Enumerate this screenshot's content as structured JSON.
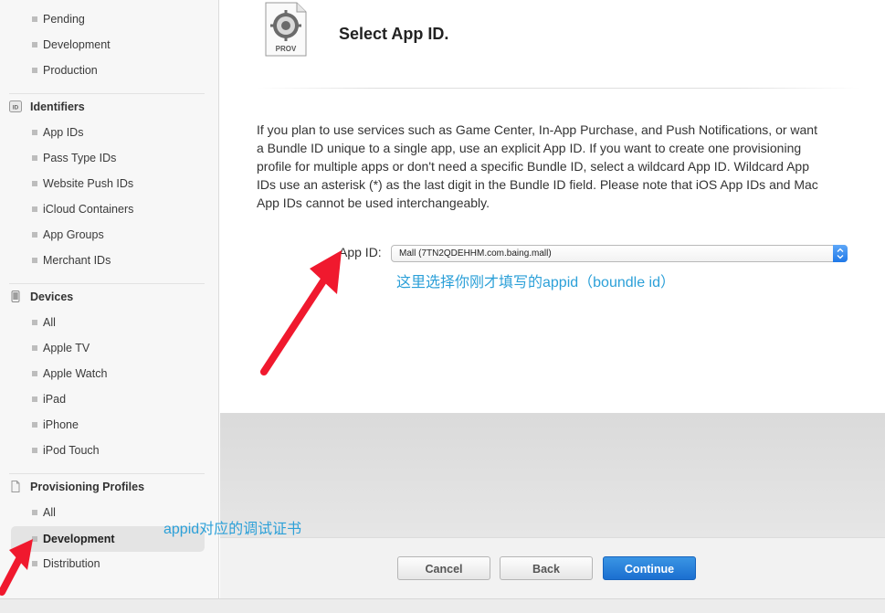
{
  "sidebar": {
    "certificates_items": [
      "Pending",
      "Development",
      "Production"
    ],
    "identifiers": {
      "header": "Identifiers",
      "icon": "id-badge-icon",
      "items": [
        "App IDs",
        "Pass Type IDs",
        "Website Push IDs",
        "iCloud Containers",
        "App Groups",
        "Merchant IDs"
      ]
    },
    "devices": {
      "header": "Devices",
      "icon": "phone-icon",
      "items": [
        "All",
        "Apple TV",
        "Apple Watch",
        "iPad",
        "iPhone",
        "iPod Touch"
      ]
    },
    "profiles": {
      "header": "Provisioning Profiles",
      "icon": "document-icon",
      "items": [
        "All",
        "Development",
        "Distribution"
      ],
      "active": "Development"
    }
  },
  "main": {
    "icon_label": "PROV",
    "title": "Select App ID.",
    "description": "If you plan to use services such as Game Center, In-App Purchase, and Push Notifications, or want a Bundle ID unique to a single app, use an explicit App ID. If you want to create one provisioning profile for multiple apps or don't need a specific Bundle ID, select a wildcard App ID. Wildcard App IDs use an asterisk (*) as the last digit in the Bundle ID field. Please note that iOS App IDs and Mac App IDs cannot be used interchangeably.",
    "appid_label": "App ID:",
    "appid_value": "Mall (7TN2QDEHHM.com.baing.mall)"
  },
  "annotations": {
    "appid_note": "这里选择你刚才填写的appid（boundle id）",
    "dev_note": "appid对应的调试证书",
    "color": "#2ca0d8",
    "arrow_color": "#f0192e"
  },
  "footer": {
    "cancel": "Cancel",
    "back": "Back",
    "continue": "Continue"
  }
}
